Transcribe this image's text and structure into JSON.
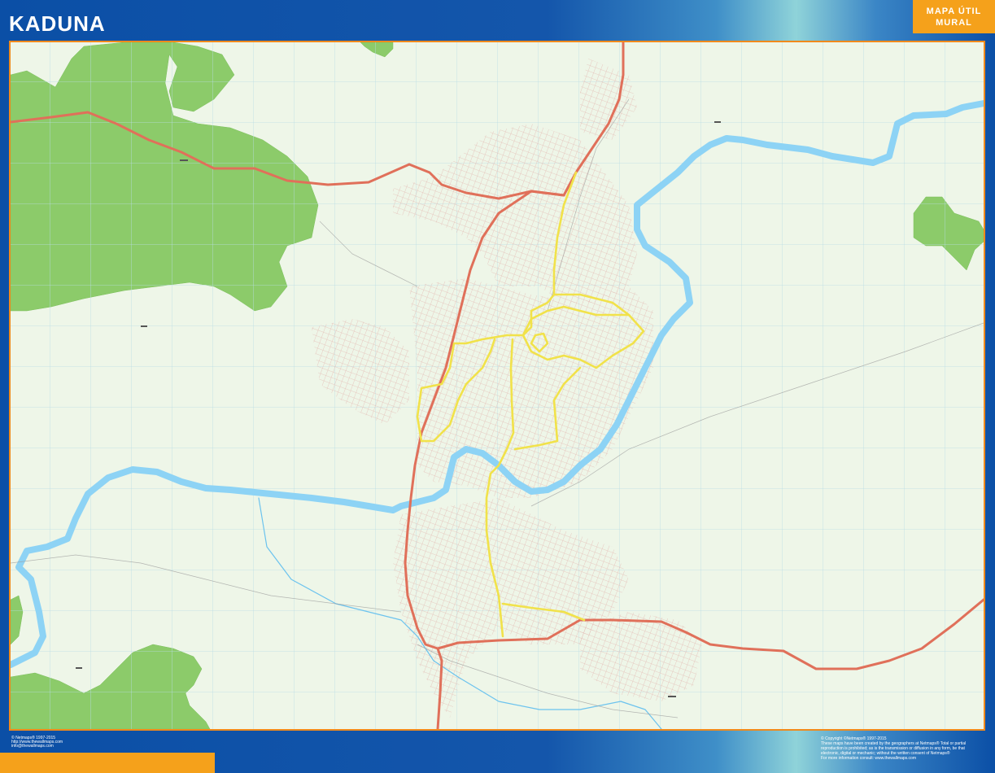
{
  "header": {
    "title": "KADUNA",
    "badge_line1": "MAPA ÚTIL",
    "badge_line2": "MURAL"
  },
  "map": {
    "colors": {
      "background": "#eef6e8",
      "grid": "#b9dde6",
      "forest": "#8ccb6a",
      "river": "#8dd3f5",
      "arterial": "#e0705a",
      "main_road": "#f1e24a",
      "streets": "#e8c6c0",
      "frame": "#f08a1c",
      "accent_orange": "#f5a11b"
    }
  },
  "footer": {
    "left_line1": "© Netmaps® 1997-2015",
    "left_line2": "http://www.thewallmaps.com",
    "left_line3": "info@thewallmaps.com",
    "right_line1": "© Copyright ©Netmaps® 1997-2015",
    "right_line2": "These maps have been created by the geographers at Netmaps® Total or partial",
    "right_line3": "reproduction is prohibited; as is the transmission or diffusion in any form, be that",
    "right_line4": "electronic, digital or mechanic; without the written consent of Netmaps®",
    "right_line5": "For more information consult: www.thewallmaps.com"
  }
}
